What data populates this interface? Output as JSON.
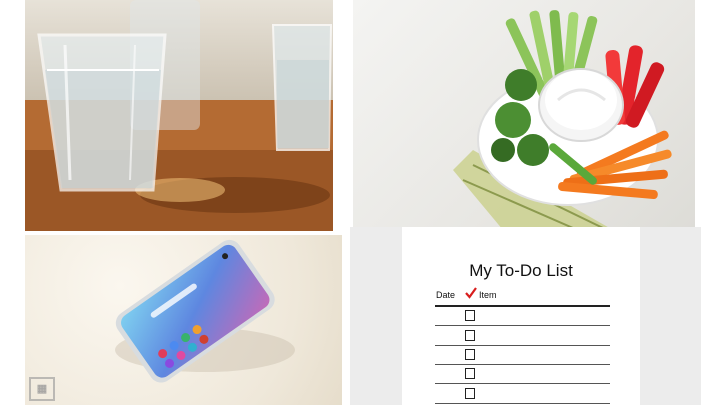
{
  "tiles": {
    "water": {
      "subject": "glasses-of-water"
    },
    "veggies": {
      "subject": "vegetable-platter-with-dip"
    },
    "phone": {
      "subject": "smartphone-on-leather"
    },
    "todo": {
      "title": "My To-Do List",
      "col_date": "Date",
      "col_item": "Item",
      "checkmark_color": "#d81e1e",
      "row_count": 5
    }
  },
  "colors": {
    "wood": "#a8612c",
    "carrot": "#f47a1f",
    "pepper": "#e3242b",
    "broccoli": "#3f7d2a",
    "phone_screen": "#7fb4e8"
  }
}
